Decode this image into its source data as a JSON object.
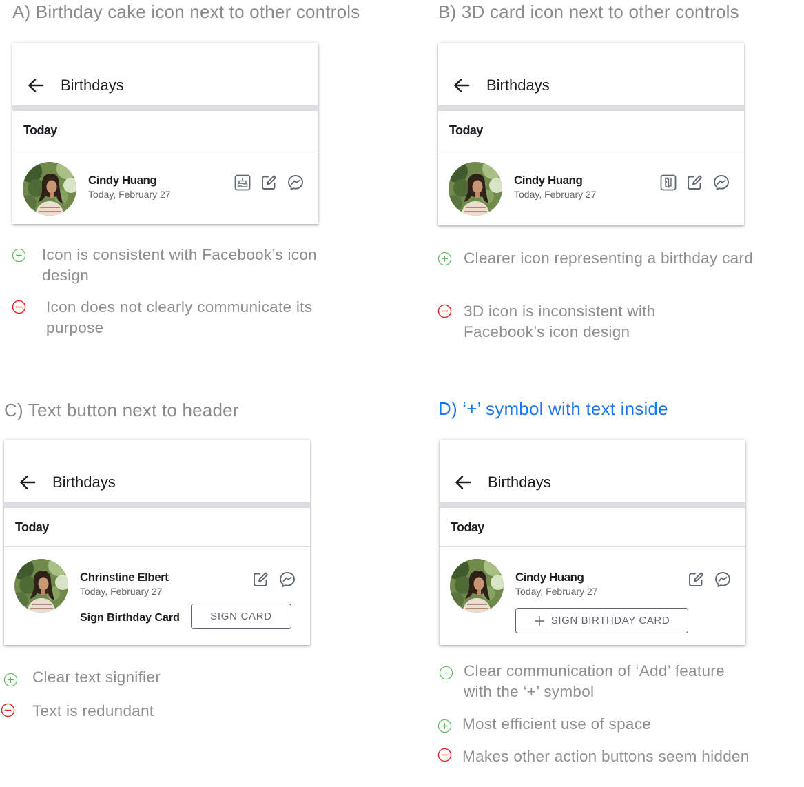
{
  "variants": {
    "a": {
      "title": "A) Birthday cake icon next to other controls",
      "header_title": "Birthdays",
      "section_label": "Today",
      "person": {
        "name": "Cindy Huang",
        "date": "Today, February 27"
      },
      "icons": [
        "birthday-cake-icon",
        "compose-icon",
        "messenger-icon"
      ],
      "notes": [
        {
          "kind": "pro",
          "text": "Icon is consistent with Facebook’s icon design"
        },
        {
          "kind": "con",
          "text": "Icon does not clearly communicate its purpose"
        }
      ]
    },
    "b": {
      "title": "B) 3D card icon next to other controls",
      "header_title": "Birthdays",
      "section_label": "Today",
      "person": {
        "name": "Cindy Huang",
        "date": "Today, February 27"
      },
      "icons": [
        "3d-card-icon",
        "compose-icon",
        "messenger-icon"
      ],
      "notes": [
        {
          "kind": "pro",
          "text": "Clearer icon representing a birthday card"
        },
        {
          "kind": "con",
          "text": "3D icon is inconsistent with Facebook’s icon design"
        }
      ]
    },
    "c": {
      "title": "C) Text button next to header",
      "header_title": "Birthdays",
      "section_label": "Today",
      "person": {
        "name": "Chrinstine Elbert",
        "date": "Today, February 27"
      },
      "inline_label": "Sign Birthday Card",
      "button_label": "SIGN CARD",
      "icons": [
        "compose-icon",
        "messenger-icon"
      ],
      "notes": [
        {
          "kind": "pro",
          "text": "Clear text signifier"
        },
        {
          "kind": "con",
          "text": "Text is redundant"
        }
      ]
    },
    "d": {
      "title": "D) ‘+’ symbol with text inside",
      "header_title": "Birthdays",
      "section_label": "Today",
      "person": {
        "name": "Cindy Huang",
        "date": "Today, February 27"
      },
      "button_label": "SIGN BIRTHDAY CARD",
      "icons": [
        "compose-icon",
        "messenger-icon",
        "plus-icon"
      ],
      "notes": [
        {
          "kind": "pro",
          "text": "Clear communication of ‘Add’ feature with the ‘+’ symbol"
        },
        {
          "kind": "pro",
          "text": "Most efficient use of space"
        },
        {
          "kind": "con",
          "text": "Makes other action buttons seem hidden"
        }
      ]
    }
  },
  "colors": {
    "title_gray": "#8a8a8a",
    "title_active": "#1877f2",
    "note_text": "#8e8e8e",
    "pro_green": "#5cb85c",
    "con_red": "#e02424",
    "divider": "#dadde1",
    "icon_dark": "#606770"
  }
}
